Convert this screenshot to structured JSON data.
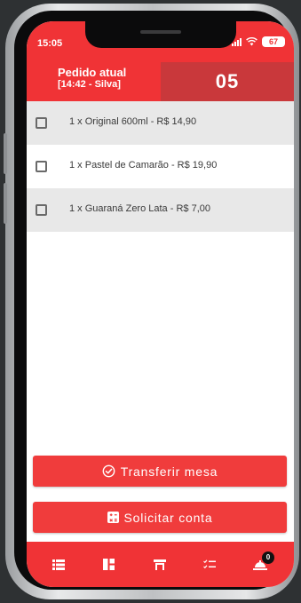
{
  "status_bar": {
    "time": "15:05",
    "battery": "67"
  },
  "order": {
    "title": "Pedido atual",
    "subtitle": "[14:42 - Silva]",
    "table_number": "05"
  },
  "items": [
    {
      "label": "1 x Original 600ml - R$ 14,90",
      "checked": false
    },
    {
      "label": "1 x Pastel de Camarão - R$ 19,90",
      "checked": false
    },
    {
      "label": "1 x Guaraná Zero Lata - R$ 7,00",
      "checked": false
    }
  ],
  "actions": {
    "transfer_label": "Transferir mesa",
    "bill_label": "Solicitar conta"
  },
  "bottom_nav": {
    "items": [
      "list-icon",
      "dashboard-icon",
      "table-icon",
      "checklist-icon",
      "bell-icon"
    ],
    "badge_count": "0"
  },
  "colors": {
    "brand_red": "#f03336",
    "header_dark_red": "#c9383b",
    "button_red": "#f03c3c",
    "row_shade": "#e8e8e8"
  }
}
